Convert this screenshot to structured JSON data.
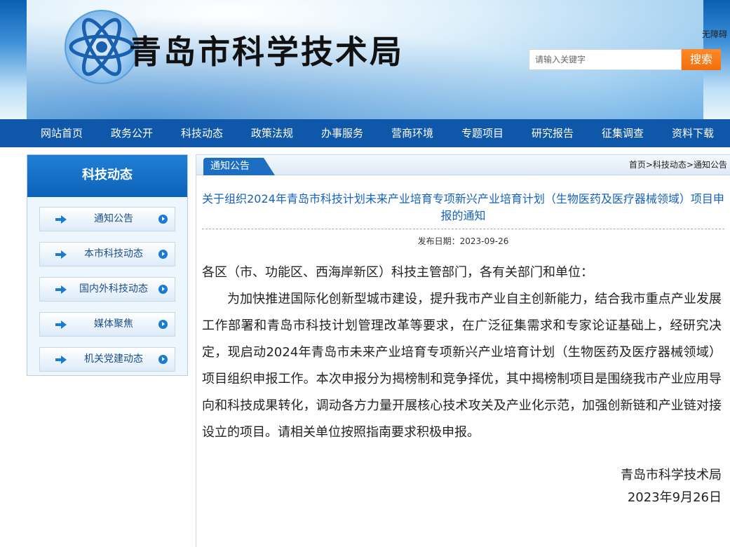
{
  "header": {
    "site_title": "青岛市科学技术局",
    "access_link": "无障碍",
    "search_placeholder": "请输入关键字",
    "search_button": "搜索"
  },
  "nav": {
    "items": [
      "网站首页",
      "政务公开",
      "科技动态",
      "政策法规",
      "办事服务",
      "营商环境",
      "专题项目",
      "研究报告",
      "征集调查",
      "资料下载"
    ]
  },
  "sidebar": {
    "title": "科技动态",
    "items": [
      "通知公告",
      "本市科技动态",
      "国内外科技动态",
      "媒体聚焦",
      "机关党建动态"
    ]
  },
  "main": {
    "tab_label": "通知公告",
    "breadcrumb": "首页>科技动态>通知公告",
    "article_title": "关于组织2024年青岛市科技计划未来产业培育专项新兴产业培育计划（生物医药及医疗器械领域）项目申报的通知",
    "publish_date": "发布日期：2023-09-26",
    "salutation": "各区（市、功能区、西海岸新区）科技主管部门，各有关部门和单位：",
    "paragraph": "为加快推进国际化创新型城市建设，提升我市产业自主创新能力，结合我市重点产业发展工作部署和青岛市科技计划管理改革等要求，在广泛征集需求和专家论证基础上，经研究决定，现启动2024年青岛市未来产业培育专项新兴产业培育计划（生物医药及医疗器械领域）项目组织申报工作。本次申报分为揭榜制和竞争择优，其中揭榜制项目是围绕我市产业应用导向和科技成果转化，调动各方力量开展核心技术攻关及产业化示范，加强创新链和产业链对接设立的项目。请相关单位按照指南要求积极申报。",
    "signature_org": "青岛市科学技术局",
    "signature_date": "2023年9月26日"
  },
  "colors": {
    "nav_bg": "#0f57a8",
    "title_blue": "#1462ba",
    "search_orange": "#f16f0b"
  }
}
